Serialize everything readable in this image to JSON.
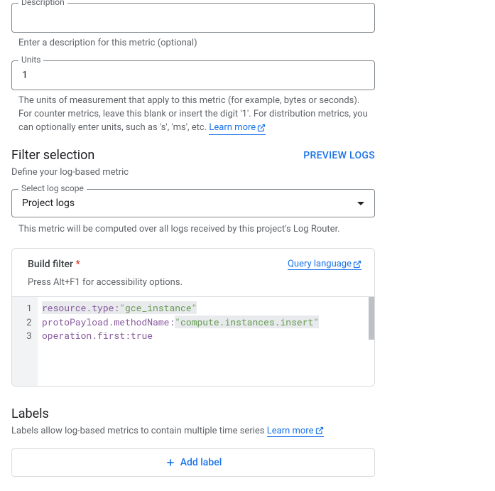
{
  "description": {
    "label": "Description",
    "value": "",
    "helper": "Enter a description for this metric (optional)"
  },
  "units": {
    "label": "Units",
    "value": "1",
    "helper": "The units of measurement that apply to this metric (for example, bytes or seconds). For counter metrics, leave this blank or insert the digit '1'. For distribution metrics, you can optionally enter units, such as 's', 'ms', etc. ",
    "learn_more": "Learn more"
  },
  "filter": {
    "title": "Filter selection",
    "preview": "PREVIEW LOGS",
    "desc": "Define your log-based metric",
    "scope_label": "Select log scope",
    "scope_value": "Project logs",
    "scope_helper": "This metric will be computed over all logs received by this project's Log Router.",
    "build_label": "Build filter",
    "query_lang": "Query language",
    "accessibility": "Press Alt+F1 for accessibility options.",
    "code": [
      {
        "key": "resource.type",
        "value": "\"gce_instance\""
      },
      {
        "key": "protoPayload.methodName",
        "value": "\"compute.instances.insert\""
      },
      {
        "key": "operation.first",
        "value": "true"
      }
    ]
  },
  "labels": {
    "title": "Labels",
    "desc": "Labels allow log-based metrics to contain multiple time series ",
    "learn_more": "Learn more",
    "add_button": "Add label"
  }
}
